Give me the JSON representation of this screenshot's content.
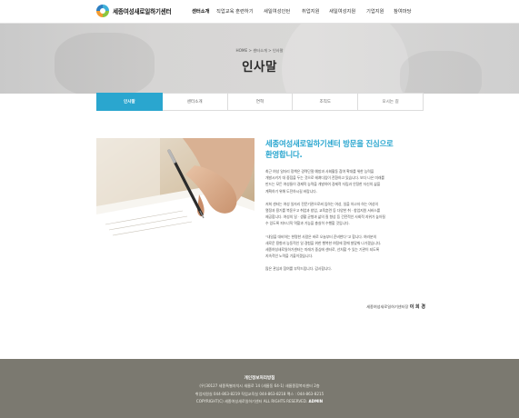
{
  "header": {
    "logo_text": "세종여성새로일하기센터",
    "nav": [
      "센터소개",
      "직업교육 훈련하기",
      "새일여성인턴",
      "취업지원",
      "새일여성지원",
      "기업지원",
      "참여마당"
    ]
  },
  "hero": {
    "breadcrumb": "HOME > 센터소개 > 인사말",
    "title": "인사말"
  },
  "tabs": [
    "인사말",
    "센터소개",
    "연혁",
    "조직도",
    "오시는 길"
  ],
  "content": {
    "headline_line1": "세종여성새로일하기센터 방문을 진심으로",
    "headline_line2": "환영합니다.",
    "paragraphs": [
      [
        "최근 여성 일자리 정책은 경력단절 예방과 사회활동 참여 확대를 위한 능력을",
        "개발시키기 대 중점을 두는 것으로 헤쳐다임이 전환하고 있습니다. 보다 나은 미래를",
        "만드는 모든 여성들이 경제적 능력을 개발하여 경제적 자립과 안정한 자신의 삶을",
        "계획하기 위해 도전하시길 바랍니다."
      ],
      [
        "저희 센터는 여성 일자리 전문기관으로써 임하는 여성, 일을 하고자 하는 여성의",
        "열정과 용기를 북돋우고 취업과 창업, 교육훈련 등 다양한 취 · 창업지원 서비스를",
        "제공합니다. 여성의 일 · 생활 균형과 삶의 질 향상 등 건전적인 사회적 지위가 높아질",
        "수 있도록 피드너직 역할과 기능을 충실히 수행할 것입니다."
      ],
      [
        "“내일을 대비하는 현명한 사람은 바로 오늘부터 준비한다”고 합니다. 여러분의",
        "새로운 용향과 능동적인 일 경험을 위한 행복한 여정에 함께 발맞춰 나가겠습니다.",
        "세종여성새로일하기센터는 미래가 중심에 센터로, 선처할 수 있는 기관이 되도록",
        "지속적인 노력을 기울이겠습니다."
      ],
      [
        "많은 관심과 참여를 부탁드립니다. 감사합니다."
      ]
    ],
    "signature_org": "세종여성새로일하기센터장",
    "signature_name": "이 희 경"
  },
  "footer": {
    "title": "개인정보처리방침",
    "line1": "(우)30127 세종특별자치시 새롬로 14 (새롬동 64-1) 새롬종합복지센터 2층",
    "line2": "취업지원실 044-863-8219    직업교육실 044-863-8218    팩스 : 044-863-8215",
    "line3_prefix": "COPYRIGHT(C) 세종여성새로일하기센터 ALL RIGHTS RESERVED. ",
    "admin": "ADMIN"
  },
  "colors": {
    "accent": "#2aa6cf",
    "footer_bg": "#7b7970"
  },
  "icons": [
    "logo-mark"
  ]
}
